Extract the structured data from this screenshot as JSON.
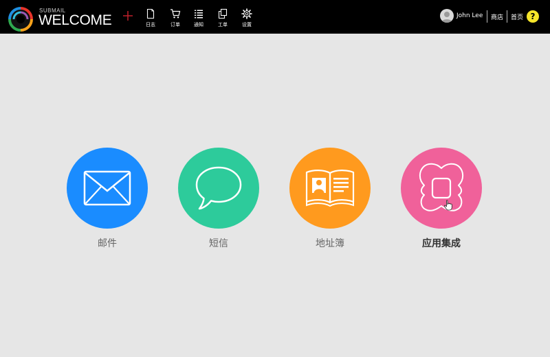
{
  "header": {
    "brand_small": "SUBMAIL",
    "brand_big": "WELCOME",
    "nav": [
      {
        "label": "日志",
        "icon": "document-icon"
      },
      {
        "label": "订单",
        "icon": "cart-icon"
      },
      {
        "label": "通知",
        "icon": "list-icon"
      },
      {
        "label": "工单",
        "icon": "copy-icon"
      },
      {
        "label": "设置",
        "icon": "gear-icon"
      }
    ],
    "user_name": "John Lee",
    "store_link": "商店",
    "home_link": "首页",
    "help_label": "?"
  },
  "apps": [
    {
      "label": "邮件",
      "color": "#1a8cff",
      "icon": "envelope-icon"
    },
    {
      "label": "短信",
      "color": "#2dcb9b",
      "icon": "speech-bubble-icon"
    },
    {
      "label": "地址簿",
      "color": "#ff9a1e",
      "icon": "address-book-icon"
    },
    {
      "label": "应用集成",
      "color": "#f0619a",
      "icon": "integration-icon"
    }
  ],
  "colors": {
    "topbar": "#000000",
    "background": "#e6e6e6",
    "help_badge": "#f5e52a",
    "plus": "#c0202a"
  }
}
